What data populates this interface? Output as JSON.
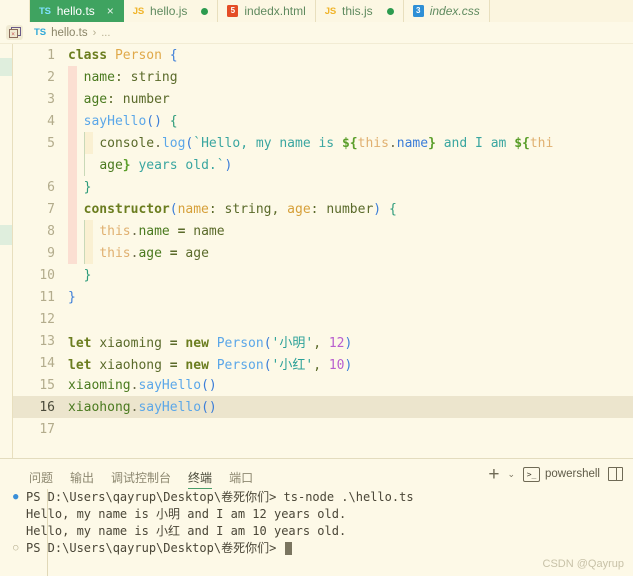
{
  "tabs": [
    {
      "label": "hello.ts",
      "icon": "typescript-icon",
      "badge": "TS",
      "active": true,
      "close": "×",
      "dirty": false,
      "italic": false
    },
    {
      "label": "hello.js",
      "icon": "javascript-icon",
      "badge": "JS",
      "active": false,
      "dirty": true,
      "italic": false
    },
    {
      "label": "indedx.html",
      "icon": "html-icon",
      "badge": "5",
      "active": false,
      "dirty": false,
      "italic": false
    },
    {
      "label": "this.js",
      "icon": "javascript-icon",
      "badge": "JS",
      "active": false,
      "dirty": true,
      "italic": false
    },
    {
      "label": "index.css",
      "icon": "css-icon",
      "badge": "3",
      "active": false,
      "dirty": false,
      "italic": true
    }
  ],
  "breadcrumb": {
    "badge": "TS",
    "file": "hello.ts",
    "separator": "›",
    "more": "..."
  },
  "editor": {
    "current_line": 16,
    "lines": [
      {
        "num": "1",
        "indent": 0,
        "tokens": [
          {
            "t": "class",
            "c": "kw"
          },
          {
            "t": " ",
            "c": "plain"
          },
          {
            "t": "Person",
            "c": "cls"
          },
          {
            "t": " ",
            "c": "plain"
          },
          {
            "t": "{",
            "c": "punc"
          }
        ]
      },
      {
        "num": "2",
        "indent": 1,
        "tokens": [
          {
            "t": "name",
            "c": "prop"
          },
          {
            "t": ":",
            "c": "plain"
          },
          {
            "t": " ",
            "c": "plain"
          },
          {
            "t": "string",
            "c": "plain"
          }
        ]
      },
      {
        "num": "3",
        "indent": 1,
        "tokens": [
          {
            "t": "age",
            "c": "prop"
          },
          {
            "t": ":",
            "c": "plain"
          },
          {
            "t": " ",
            "c": "plain"
          },
          {
            "t": "number",
            "c": "plain"
          }
        ]
      },
      {
        "num": "4",
        "indent": 1,
        "tokens": [
          {
            "t": "sayHello",
            "c": "fn"
          },
          {
            "t": "()",
            "c": "paren"
          },
          {
            "t": " ",
            "c": "plain"
          },
          {
            "t": "{",
            "c": "punc2"
          }
        ]
      },
      {
        "num": "5",
        "indent": 2,
        "tokens": [
          {
            "t": "console",
            "c": "plain"
          },
          {
            "t": ".",
            "c": "dot"
          },
          {
            "t": "log",
            "c": "fn"
          },
          {
            "t": "(",
            "c": "paren"
          },
          {
            "t": "`Hello, my name is ",
            "c": "tmpl"
          },
          {
            "t": "${",
            "c": "dollar"
          },
          {
            "t": "this",
            "c": "this"
          },
          {
            "t": ".",
            "c": "dot"
          },
          {
            "t": "name",
            "c": "punc"
          },
          {
            "t": "}",
            "c": "dollar"
          },
          {
            "t": " and I am ",
            "c": "tmpl"
          },
          {
            "t": "${",
            "c": "dollar"
          },
          {
            "t": "thi",
            "c": "this"
          }
        ]
      },
      {
        "num": "",
        "indent": 2,
        "tokens": [
          {
            "t": "age",
            "c": "prop"
          },
          {
            "t": "}",
            "c": "dollar"
          },
          {
            "t": " years old.`",
            "c": "tmpl"
          },
          {
            "t": ")",
            "c": "paren"
          }
        ]
      },
      {
        "num": "6",
        "indent": 1,
        "tokens": [
          {
            "t": "}",
            "c": "punc2"
          }
        ]
      },
      {
        "num": "7",
        "indent": 1,
        "tokens": [
          {
            "t": "constructor",
            "c": "kw"
          },
          {
            "t": "(",
            "c": "paren"
          },
          {
            "t": "name",
            "c": "type"
          },
          {
            "t": ":",
            "c": "plain"
          },
          {
            "t": " ",
            "c": "plain"
          },
          {
            "t": "string",
            "c": "plain"
          },
          {
            "t": ", ",
            "c": "plain"
          },
          {
            "t": "age",
            "c": "type"
          },
          {
            "t": ":",
            "c": "plain"
          },
          {
            "t": " ",
            "c": "plain"
          },
          {
            "t": "number",
            "c": "plain"
          },
          {
            "t": ")",
            "c": "paren"
          },
          {
            "t": " ",
            "c": "plain"
          },
          {
            "t": "{",
            "c": "punc2"
          }
        ]
      },
      {
        "num": "8",
        "indent": 2,
        "tokens": [
          {
            "t": "this",
            "c": "this"
          },
          {
            "t": ".",
            "c": "dot"
          },
          {
            "t": "name",
            "c": "prop"
          },
          {
            "t": " ",
            "c": "plain"
          },
          {
            "t": "=",
            "c": "op"
          },
          {
            "t": " ",
            "c": "plain"
          },
          {
            "t": "name",
            "c": "plain"
          }
        ]
      },
      {
        "num": "9",
        "indent": 2,
        "tokens": [
          {
            "t": "this",
            "c": "this"
          },
          {
            "t": ".",
            "c": "dot"
          },
          {
            "t": "age",
            "c": "prop"
          },
          {
            "t": " ",
            "c": "plain"
          },
          {
            "t": "=",
            "c": "op"
          },
          {
            "t": " ",
            "c": "plain"
          },
          {
            "t": "age",
            "c": "plain"
          }
        ]
      },
      {
        "num": "10",
        "indent": 1,
        "tokens": [
          {
            "t": "}",
            "c": "punc2"
          }
        ]
      },
      {
        "num": "11",
        "indent": 0,
        "tokens": [
          {
            "t": "}",
            "c": "punc"
          }
        ]
      },
      {
        "num": "12",
        "indent": 0,
        "tokens": []
      },
      {
        "num": "13",
        "indent": 0,
        "tokens": [
          {
            "t": "let",
            "c": "kw"
          },
          {
            "t": " ",
            "c": "plain"
          },
          {
            "t": "xiaoming",
            "c": "plain"
          },
          {
            "t": " ",
            "c": "plain"
          },
          {
            "t": "=",
            "c": "op"
          },
          {
            "t": " ",
            "c": "plain"
          },
          {
            "t": "new",
            "c": "kw"
          },
          {
            "t": " ",
            "c": "plain"
          },
          {
            "t": "Person",
            "c": "fn"
          },
          {
            "t": "(",
            "c": "paren"
          },
          {
            "t": "'小明'",
            "c": "str"
          },
          {
            "t": ", ",
            "c": "plain"
          },
          {
            "t": "12",
            "c": "num"
          },
          {
            "t": ")",
            "c": "paren"
          }
        ]
      },
      {
        "num": "14",
        "indent": 0,
        "tokens": [
          {
            "t": "let",
            "c": "kw"
          },
          {
            "t": " ",
            "c": "plain"
          },
          {
            "t": "xiaohong",
            "c": "plain"
          },
          {
            "t": " ",
            "c": "plain"
          },
          {
            "t": "=",
            "c": "op"
          },
          {
            "t": " ",
            "c": "plain"
          },
          {
            "t": "new",
            "c": "kw"
          },
          {
            "t": " ",
            "c": "plain"
          },
          {
            "t": "Person",
            "c": "fn"
          },
          {
            "t": "(",
            "c": "paren"
          },
          {
            "t": "'小红'",
            "c": "str"
          },
          {
            "t": ", ",
            "c": "plain"
          },
          {
            "t": "10",
            "c": "num"
          },
          {
            "t": ")",
            "c": "paren"
          }
        ]
      },
      {
        "num": "15",
        "indent": 0,
        "tokens": [
          {
            "t": "xiaoming",
            "c": "var"
          },
          {
            "t": ".",
            "c": "dot"
          },
          {
            "t": "sayHello",
            "c": "fn"
          },
          {
            "t": "()",
            "c": "paren"
          }
        ]
      },
      {
        "num": "16",
        "indent": 0,
        "current": true,
        "tokens": [
          {
            "t": "xiaohong",
            "c": "var"
          },
          {
            "t": ".",
            "c": "dot"
          },
          {
            "t": "sayHello",
            "c": "fn"
          },
          {
            "t": "()",
            "c": "paren"
          }
        ]
      },
      {
        "num": "17",
        "indent": 0,
        "tokens": []
      }
    ]
  },
  "panel": {
    "tabs": [
      {
        "label": "问题",
        "active": false
      },
      {
        "label": "输出",
        "active": false
      },
      {
        "label": "调试控制台",
        "active": false
      },
      {
        "label": "终端",
        "active": true
      },
      {
        "label": "端口",
        "active": false
      }
    ],
    "new_terminal_label": "+",
    "dropdown_label": "⌄",
    "shell_name": "powershell",
    "shell_glyph": ">_",
    "terminal_lines": [
      {
        "bullet": "filled",
        "text": "PS D:\\Users\\qayrup\\Desktop\\卷死你们> ts-node .\\hello.ts"
      },
      {
        "bullet": "none",
        "text": "Hello, my name is 小明 and I am 12 years old."
      },
      {
        "bullet": "none",
        "text": "Hello, my name is 小红 and I am 10 years old."
      },
      {
        "bullet": "hollow",
        "text": "PS D:\\Users\\qayrup\\Desktop\\卷死你们> ",
        "cursor": true
      }
    ]
  },
  "watermark": "CSDN @Qayrup",
  "colors": {
    "editor_bg": "#fdf9e7",
    "active_tab_bg": "#3fa360",
    "current_line_bg": "#ece5cd",
    "indent_guide_1": "#fbdfd2",
    "indent_guide_2": "#faf0d2",
    "accent_underline": "#4a9e6a",
    "dirty_dot": "#2c9b4f"
  }
}
